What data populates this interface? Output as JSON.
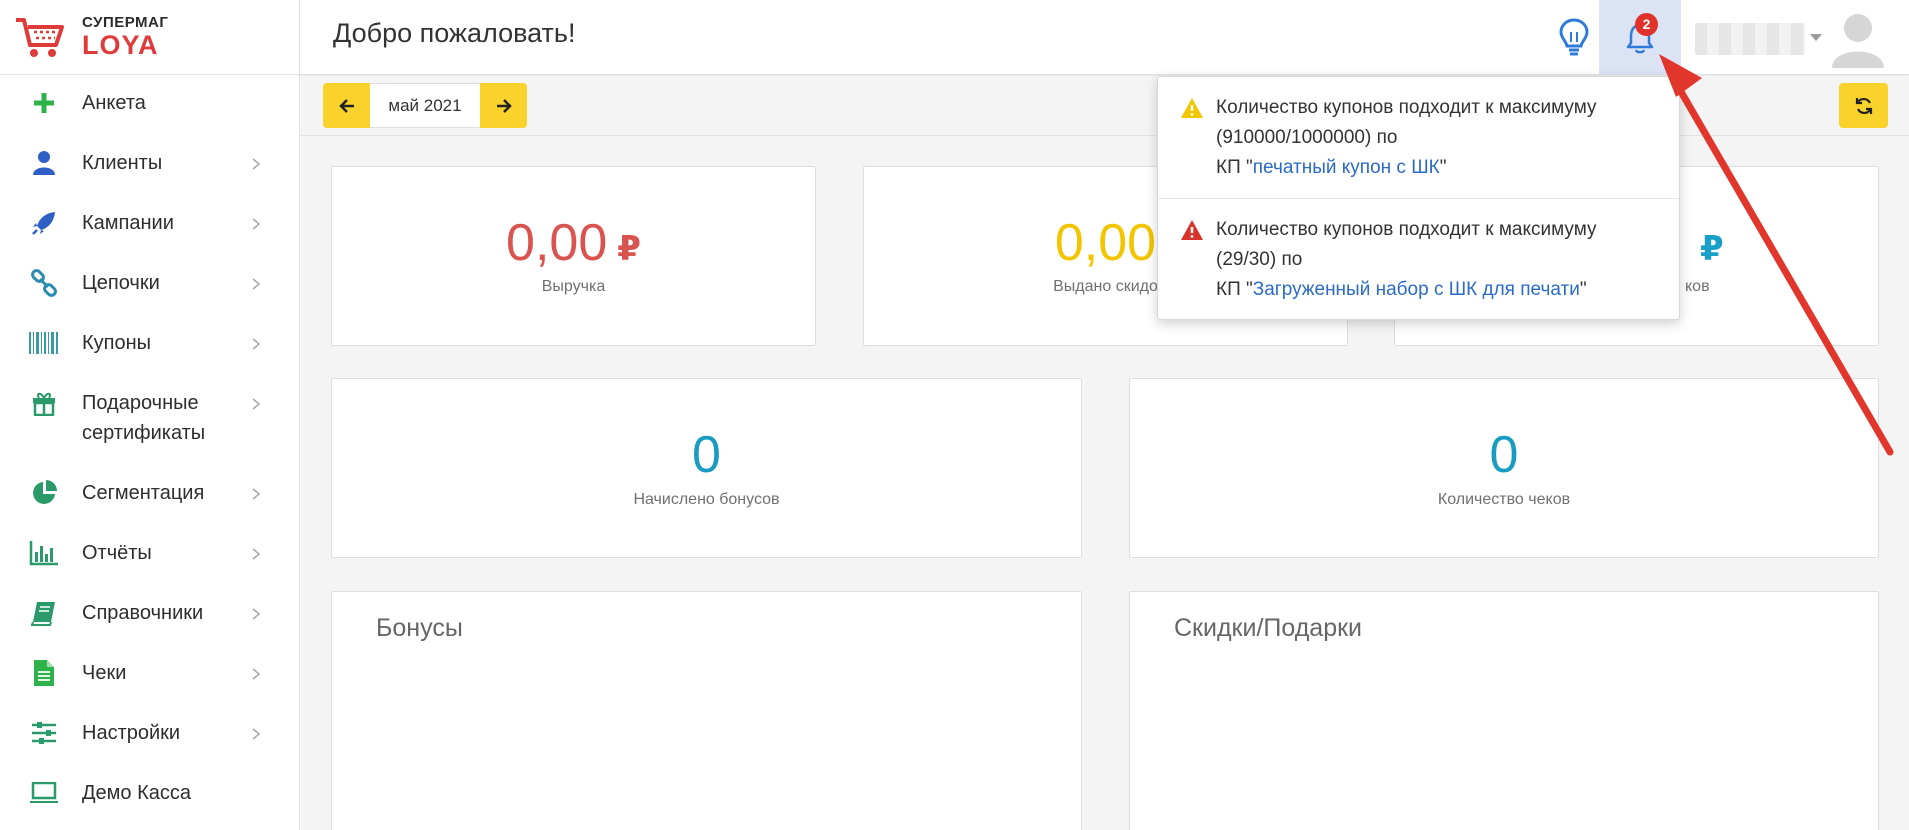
{
  "brand": {
    "top": "СУПЕРМАГ",
    "bottom": "LOYA",
    "accent": "#e03b3b"
  },
  "header": {
    "title": "Добро пожаловать!",
    "notif_count": "2"
  },
  "sidebar": {
    "items": [
      {
        "label": "Анкета",
        "icon": "plus-icon",
        "has_children": false
      },
      {
        "label": "Клиенты",
        "icon": "user-icon",
        "has_children": true
      },
      {
        "label": "Кампании",
        "icon": "rocket-icon",
        "has_children": true
      },
      {
        "label": "Цепочки",
        "icon": "chain-icon",
        "has_children": true
      },
      {
        "label": "Купоны",
        "icon": "barcode-icon",
        "has_children": true
      },
      {
        "label": "Подарочные сертификаты",
        "icon": "gift-icon",
        "has_children": true
      },
      {
        "label": "Сегментация",
        "icon": "pie-chart-icon",
        "has_children": true
      },
      {
        "label": "Отчёты",
        "icon": "bar-chart-icon",
        "has_children": true
      },
      {
        "label": "Справочники",
        "icon": "book-icon",
        "has_children": true
      },
      {
        "label": "Чеки",
        "icon": "document-icon",
        "has_children": true
      },
      {
        "label": "Настройки",
        "icon": "sliders-icon",
        "has_children": true
      },
      {
        "label": "Демо Касса",
        "icon": "laptop-icon",
        "has_children": false
      }
    ]
  },
  "toolbar": {
    "period": "май 2021"
  },
  "stats": {
    "revenue": {
      "value": "0,00",
      "currency": "₽",
      "label": "Выручка",
      "color": "#d9534f"
    },
    "discounts": {
      "value": "0,00",
      "label": "Выдано скидо",
      "color": "#f2c500"
    },
    "third": {
      "currency": "₽",
      "label": "ков",
      "color": "#1aa0c8"
    },
    "bonuses": {
      "value": "0",
      "label": "Начислено бонусов",
      "color": "#1a9bc1"
    },
    "checks": {
      "value": "0",
      "label": "Количество чеков",
      "color": "#1a9bc1"
    }
  },
  "panels": {
    "bonuses": "Бонусы",
    "discounts": "Скидки/Подарки"
  },
  "notifications": [
    {
      "text": "Количество купонов подходит к максимуму (910000/1000000) по",
      "prefix": "КП \"",
      "link": "печатный купон с ШК",
      "suffix": "\"",
      "level_color": "#f2c500"
    },
    {
      "text": "Количество купонов подходит к максимуму (29/30) по",
      "prefix": "КП \"",
      "link": "Загруженный набор с ШК для печати",
      "suffix": "\"",
      "level_color": "#d9332b"
    }
  ]
}
